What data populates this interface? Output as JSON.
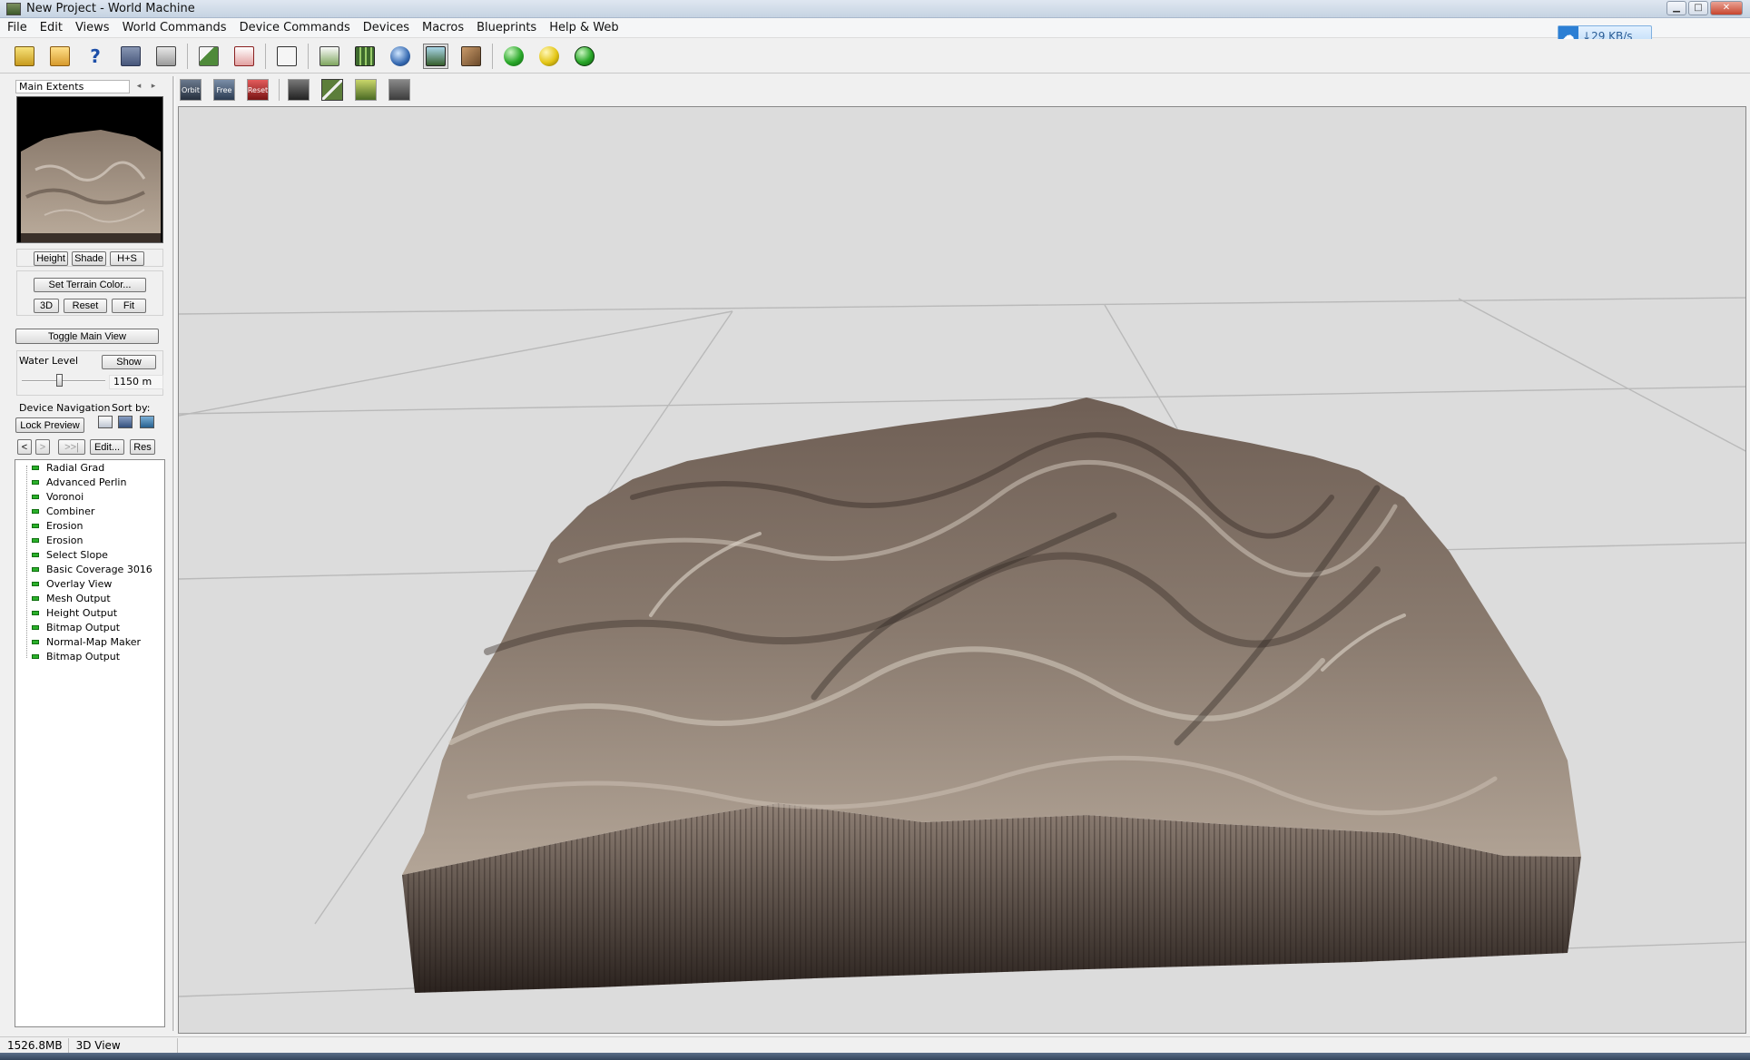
{
  "window": {
    "title": "New Project - World Machine"
  },
  "menu": [
    "File",
    "Edit",
    "Views",
    "World Commands",
    "Device Commands",
    "Devices",
    "Macros",
    "Blueprints",
    "Help & Web"
  ],
  "net_badge": {
    "speed": "29 KB/s"
  },
  "toolbar": {
    "buttons": [
      "new-project-icon",
      "open-project-icon",
      "help-icon",
      "save-icon",
      "export-icon",
      "layout-view-icon",
      "device-settings-icon",
      "dice-icon",
      "world-settings-icon",
      "tiled-build-icon",
      "globe-icon",
      "3d-view-icon",
      "texture-icon",
      "build-green-icon",
      "build-yellow-icon",
      "build-target-icon"
    ]
  },
  "preview": {
    "extent": "Main Extents",
    "modes": [
      "Height",
      "Shade",
      "H+S"
    ],
    "set_color": "Set Terrain Color...",
    "view_buttons": [
      "3D",
      "Reset",
      "Fit"
    ],
    "toggle_main": "Toggle Main View",
    "water_label": "Water Level",
    "water_show": "Show",
    "water_value": "1150 m",
    "water_level_fraction": 0.45
  },
  "navigation": {
    "label": "Device Navigation",
    "sort_label": "Sort by:",
    "lock": "Lock Preview",
    "nav": [
      "<",
      ">",
      ">>|"
    ],
    "edit": "Edit...",
    "res": "Res",
    "devices": [
      "Radial Grad",
      "Advanced Perlin",
      "Voronoi",
      "Combiner",
      "Erosion",
      "Erosion",
      "Select Slope",
      "Basic Coverage 3016",
      "Overlay View",
      "Mesh Output",
      "Height Output",
      "Bitmap Output",
      "Normal-Map Maker",
      "Bitmap Output"
    ]
  },
  "view_toolbar": {
    "buttons": [
      "Orbit",
      "Free",
      "Reset"
    ]
  },
  "status": {
    "memory": "1526.8MB",
    "view": "3D View"
  },
  "colors": {
    "device_ok": "#2bb02b",
    "viewport_bg": "#dcdcdc",
    "terrain": "#7a6a5e"
  }
}
